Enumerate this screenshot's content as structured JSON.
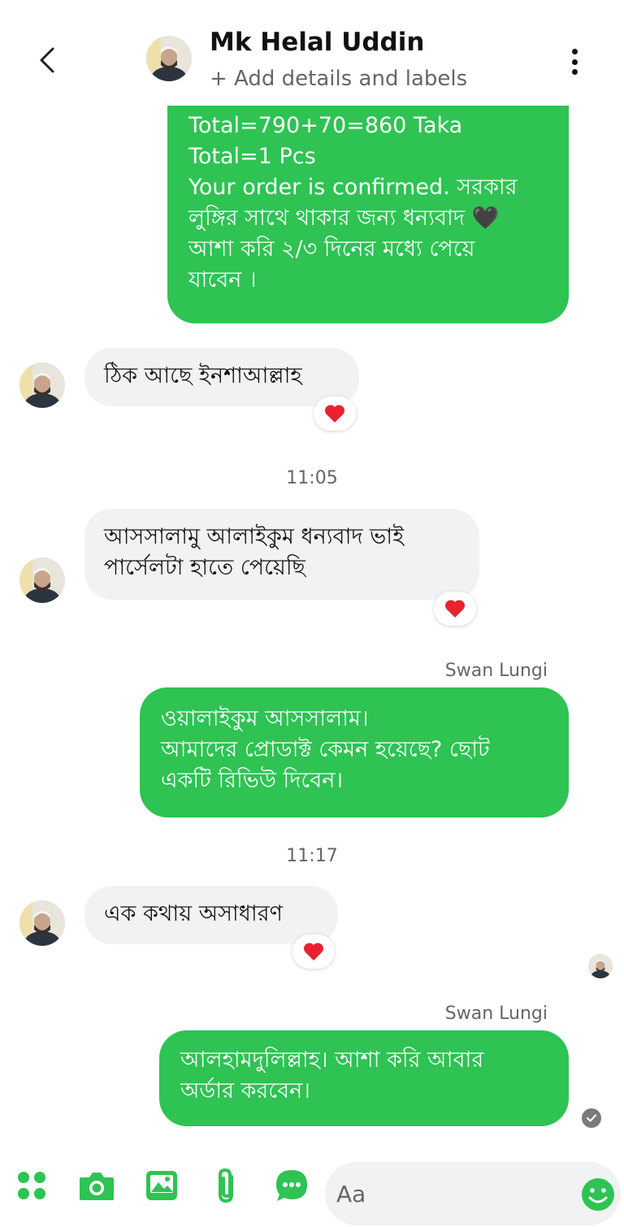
{
  "header": {
    "contact_name": "Mk Helal Uddin",
    "sub_label": "+ Add details and labels",
    "back_icon": "chevron-left-icon",
    "more_icon": "vertical-dots-icon"
  },
  "messages": [
    {
      "direction": "outgoing",
      "text": "Total=790+70=860 Taka\nTotal=1 Pcs\nYour order is confirmed. সরকার\nলুঙ্গির সাথে থাকার জন্য ধন্যবাদ 🖤\nআশা করি ২/৩ দিনের মধ্যে পেয়ে\nযাবেন ।"
    },
    {
      "direction": "incoming",
      "text": "ঠিক আছে ইনশাআল্লাহ",
      "reaction": "❤️"
    },
    {
      "timestamp": "11:05"
    },
    {
      "direction": "incoming",
      "text": "আসসালামু আলাইকুম ধন্যবাদ ভাই\nপার্সেলটা হাতে পেয়েছি",
      "reaction": "❤️"
    },
    {
      "sender": "Swan Lungi",
      "direction": "outgoing",
      "text": "ওয়ালাইকুম আসসালাম।\nআমাদের প্রোডাক্ট কেমন হয়েছে? ছোট\nএকটি রিভিউ দিবেন।"
    },
    {
      "timestamp": "11:17"
    },
    {
      "direction": "incoming",
      "text": "এক কথায় অসাধারণ",
      "reaction": "❤️"
    },
    {
      "sender": "Swan Lungi",
      "direction": "outgoing",
      "text": "আলহামদুলিল্লাহ।  আশা করি আবার\nঅর্ডার করবেন।"
    }
  ],
  "composer": {
    "placeholder": "Aa",
    "icons": [
      "apps-icon",
      "camera-icon",
      "gallery-icon",
      "attachment-icon",
      "chat-bubble-icon",
      "emoji-icon"
    ]
  },
  "colors": {
    "outgoing_bubble": "#2ec353",
    "incoming_bubble": "#f1f2f4",
    "accent": "#2ec353"
  }
}
